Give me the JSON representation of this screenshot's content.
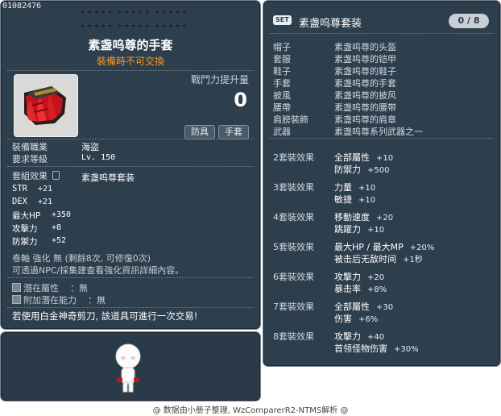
{
  "item": {
    "id": "01082476",
    "name": "素盏呜尊的手套",
    "trade_note": "裝備時不可交換",
    "power_label": "戰鬥力提升量",
    "power_value": "0",
    "tags": [
      "防具",
      "手套"
    ],
    "job_label": "裝備職業",
    "job_value": "海盜",
    "level_label": "要求等級",
    "level_value": "Lv. 150",
    "set_label": "套組效果",
    "set_value": "素盏呜尊套装",
    "stats": [
      {
        "name": "STR",
        "value": "+21"
      },
      {
        "name": "DEX",
        "value": "+21"
      },
      {
        "name": "最大HP",
        "value": "+350"
      },
      {
        "name": "攻擊力",
        "value": "+8"
      },
      {
        "name": "防禦力",
        "value": "+52"
      }
    ],
    "enhance_line1": "卷軸 強化 無 (剩餘8次, 可修復0次)",
    "enhance_line2": "可透過NPC/採集建查看強化資訊詳細內容。",
    "potential_label": "潛在屬性",
    "potential_value": "：無",
    "bonus_potential_label": "附加潛在能力",
    "bonus_potential_value": "：無",
    "scissors_note": "若使用白金神奇剪刀, 該道具可進行一次交易!",
    "icon": "red-glove-icon"
  },
  "set": {
    "badge": "SET",
    "title": "素盏呜尊套装",
    "count": "0 / 8",
    "pieces": [
      {
        "slot": "帽子",
        "name": "素盏呜尊的头盔"
      },
      {
        "slot": "套服",
        "name": "素盏呜尊的铠甲"
      },
      {
        "slot": "鞋子",
        "name": "素盏呜尊的鞋子"
      },
      {
        "slot": "手套",
        "name": "素盏呜尊的手套"
      },
      {
        "slot": "披風",
        "name": "素盏呜尊的披风"
      },
      {
        "slot": "腰帶",
        "name": "素盏呜尊的腰带"
      },
      {
        "slot": "肩膀裝飾",
        "name": "素盏呜尊的肩章"
      },
      {
        "slot": "武器",
        "name": "素盏呜尊系列武器之一"
      }
    ],
    "bonuses": [
      {
        "label": "2套裝效果",
        "lines": [
          {
            "stat": "全部屬性",
            "val": "+10"
          },
          {
            "stat": "防禦力",
            "val": "+500"
          }
        ]
      },
      {
        "label": "3套裝效果",
        "lines": [
          {
            "stat": "力量",
            "val": "+10"
          },
          {
            "stat": "敏捷",
            "val": "+10"
          }
        ]
      },
      {
        "label": "4套裝效果",
        "lines": [
          {
            "stat": "移動速度",
            "val": "+20"
          },
          {
            "stat": "跳躍力",
            "val": "+10"
          }
        ]
      },
      {
        "label": "5套裝效果",
        "lines": [
          {
            "stat": "最大HP / 最大MP",
            "val": "+20%"
          },
          {
            "stat": "被击后无敌时间",
            "val": "+1秒"
          }
        ]
      },
      {
        "label": "6套裝效果",
        "lines": [
          {
            "stat": "攻擊力",
            "val": "+20"
          },
          {
            "stat": "暴击率",
            "val": "+8%"
          }
        ]
      },
      {
        "label": "7套裝效果",
        "lines": [
          {
            "stat": "全部屬性",
            "val": "+30"
          },
          {
            "stat": "伤害",
            "val": "+6%"
          }
        ]
      },
      {
        "label": "8套裝效果",
        "lines": [
          {
            "stat": "攻擊力",
            "val": "+40"
          },
          {
            "stat": "首领怪物伤害",
            "val": "+30%"
          }
        ]
      }
    ]
  },
  "footer": "@ 数据由小册子整理, WzComparerR2-NTMS解析 @",
  "colors": {
    "panel": "#2d3e4d",
    "trade_note": "#ff9a1a",
    "border": "#7a8794"
  }
}
